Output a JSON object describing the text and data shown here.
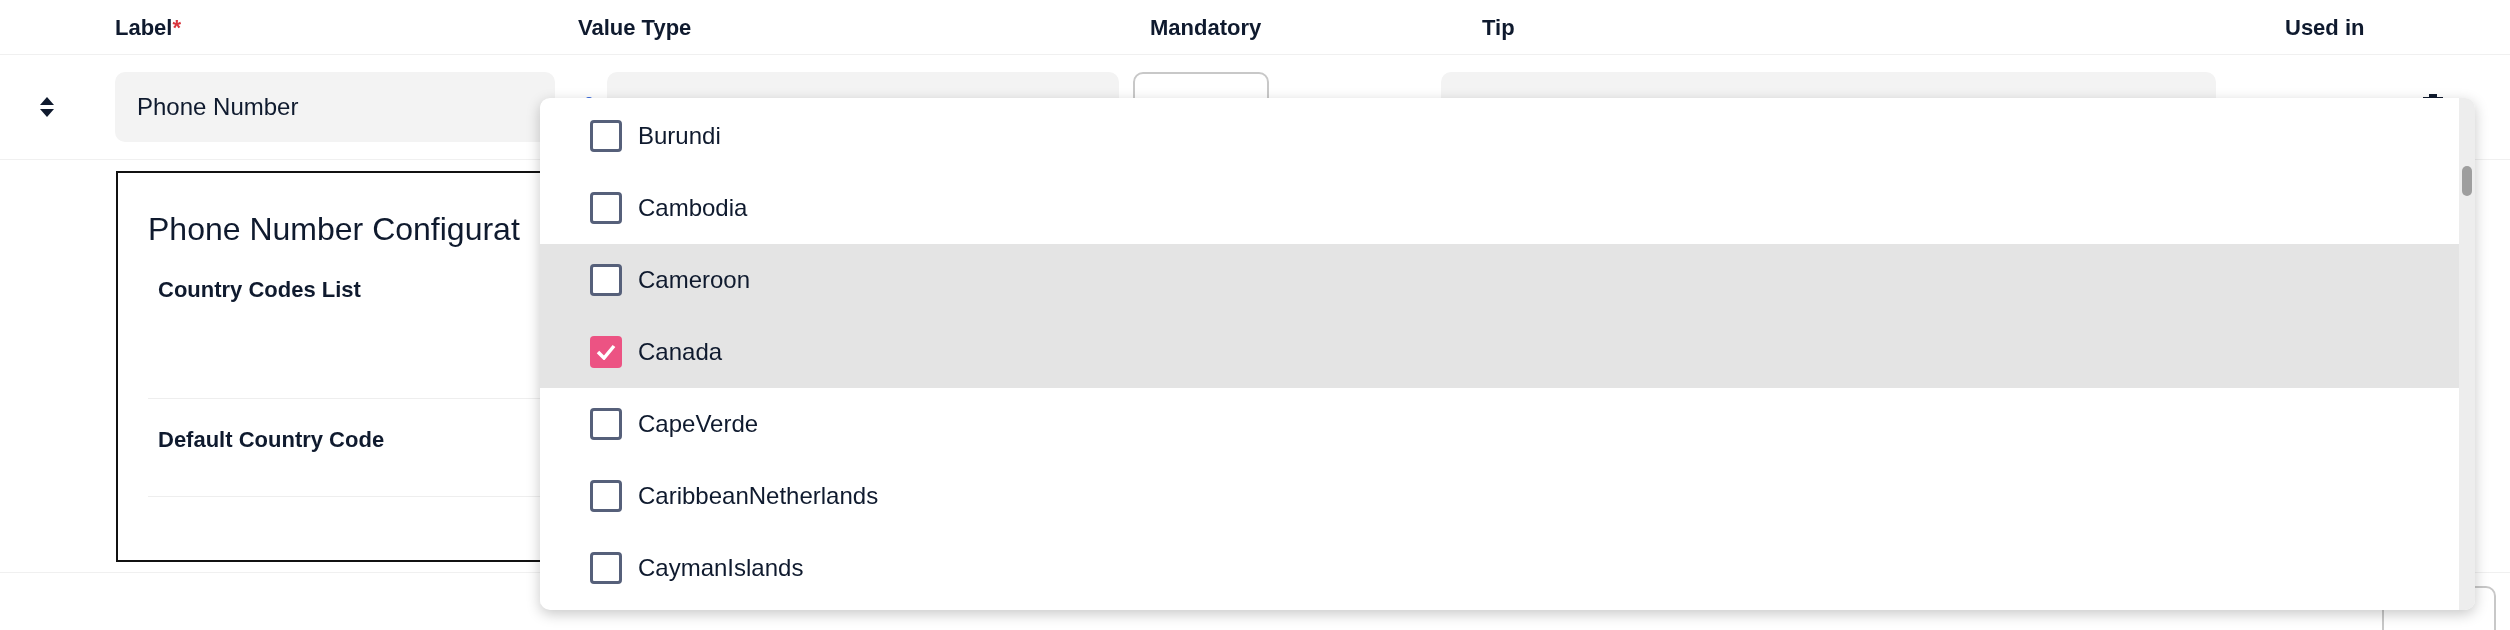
{
  "columns": [
    {
      "label": "Label",
      "required_mark": "*"
    },
    {
      "label": "Value Type"
    },
    {
      "label": "Mandatory"
    },
    {
      "label": "Tip"
    },
    {
      "label": "Used in"
    }
  ],
  "field_row": {
    "label_value": "Phone Number"
  },
  "config_panel": {
    "title": "Phone Number Configurat",
    "sections": [
      {
        "label": "Country Codes List"
      },
      {
        "label": "Default Country Code"
      }
    ]
  },
  "dropdown": {
    "options": [
      {
        "label": "Burundi",
        "checked": false,
        "highlighted": false
      },
      {
        "label": "Cambodia",
        "checked": false,
        "highlighted": false
      },
      {
        "label": "Cameroon",
        "checked": false,
        "highlighted": true
      },
      {
        "label": "Canada",
        "checked": true,
        "highlighted": true
      },
      {
        "label": "CapeVerde",
        "checked": false,
        "highlighted": false
      },
      {
        "label": "CaribbeanNetherlands",
        "checked": false,
        "highlighted": false
      },
      {
        "label": "CaymanIslands",
        "checked": false,
        "highlighted": false
      }
    ]
  }
}
